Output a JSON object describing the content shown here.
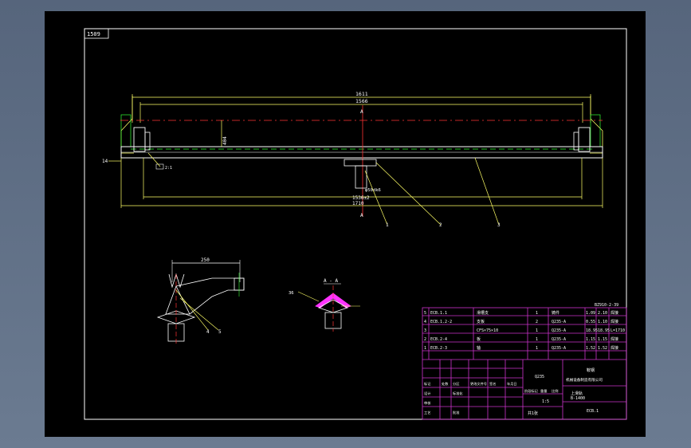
{
  "colors": {
    "background": "#5f6f86",
    "sheet": "#000000",
    "frame": "#ffffff",
    "dimension": "#ffff66",
    "center_line": "#ff3333",
    "hidden_line": "#33ff33",
    "leader": "#ffff33",
    "title_block": "#cc33cc",
    "part": "#ff33ff"
  },
  "drawing": {
    "corner_label": "1509",
    "dimensions": {
      "top_outer": "1611",
      "top_inner": "1566",
      "height": "404",
      "diameter_note": "φ50dk6",
      "bottom_inner": "1536±2",
      "bottom_outer": "1710",
      "detail_width": "250",
      "detail_height": "36"
    },
    "section_marks": [
      "A",
      "A"
    ],
    "left_marks": [
      "14",
      "2:1"
    ],
    "balloons": [
      "1",
      "2",
      "3",
      "4",
      "5"
    ],
    "section_label": "A - A"
  },
  "title_block": {
    "drawing_no": "BZ910-2-39",
    "rows": [
      {
        "idx": "5",
        "code": "ECB.1.1",
        "name": "滑槽支",
        "qty": "1",
        "mat": "铸件",
        "w1": "1.09",
        "w2": "2.10",
        "note": "焊接"
      },
      {
        "idx": "4",
        "code": "ECB.1.2-2",
        "name": "支板",
        "qty": "2",
        "mat": "Q235-A",
        "w1": "0.55",
        "w2": "1.10",
        "note": "焊接"
      },
      {
        "idx": "3",
        "code": "",
        "name": "CFS×75×10",
        "qty": "1",
        "mat": "Q235-A",
        "w1": "18.95",
        "w2": "18.95",
        "note": "L=1710"
      },
      {
        "idx": "2",
        "code": "ECB.2-4",
        "name": "板",
        "qty": "1",
        "mat": "Q235-A",
        "w1": "1.15",
        "w2": "1.15",
        "note": "焊接"
      },
      {
        "idx": "1",
        "code": "ECB.2-3",
        "name": "轴",
        "qty": "1",
        "mat": "Q235-A",
        "w1": "1.52",
        "w2": "1.52",
        "note": "焊接"
      }
    ],
    "company": "鞍钢",
    "company_sub": "机械设备制造有限公司",
    "material_label": "Q235",
    "title_name": "上滑轨",
    "spec": "B-1400",
    "part_code": "ECB.1",
    "scale": "1:5",
    "sheet_label": "共1张",
    "labels": [
      "标记",
      "处数",
      "分区",
      "更改文件号",
      "签名",
      "年月日",
      "设计",
      "标准化",
      "阶段标记",
      "重量",
      "比例",
      "审核",
      "工艺",
      "批准"
    ]
  }
}
